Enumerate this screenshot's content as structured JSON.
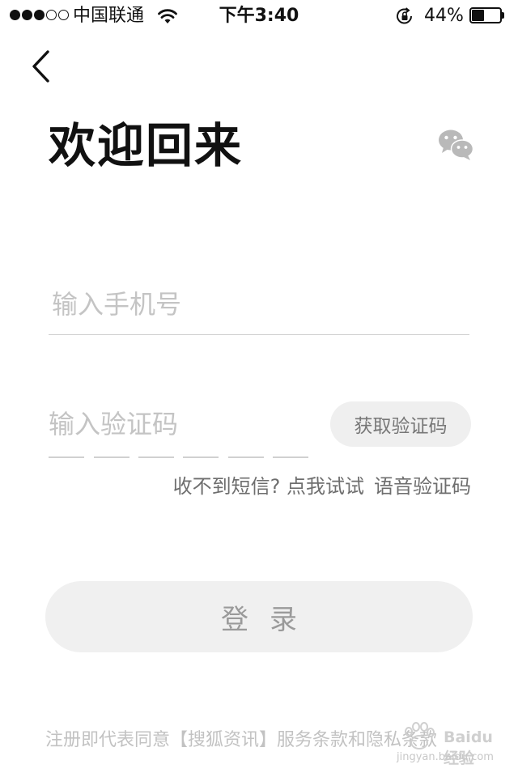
{
  "status_bar": {
    "signal_dots_filled": 3,
    "signal_dots_total": 5,
    "carrier": "中国联通",
    "time": "下午3:40",
    "battery_percent_text": "44%",
    "battery_level": 0.44
  },
  "header": {
    "title": "欢迎回来"
  },
  "form": {
    "phone_placeholder": "输入手机号",
    "code_placeholder": "输入验证码",
    "get_code_label": "获取验证码",
    "no_sms_hint": "收不到短信? 点我试试",
    "voice_code_label": "语音验证码",
    "login_label": "登录"
  },
  "terms": {
    "prefix": "注册即代表同意【搜狐资讯】服务条款和",
    "privacy_label": "隐私条款"
  },
  "watermark": {
    "brand": "Baidu经验",
    "url": "jingyan.baidu.com"
  }
}
